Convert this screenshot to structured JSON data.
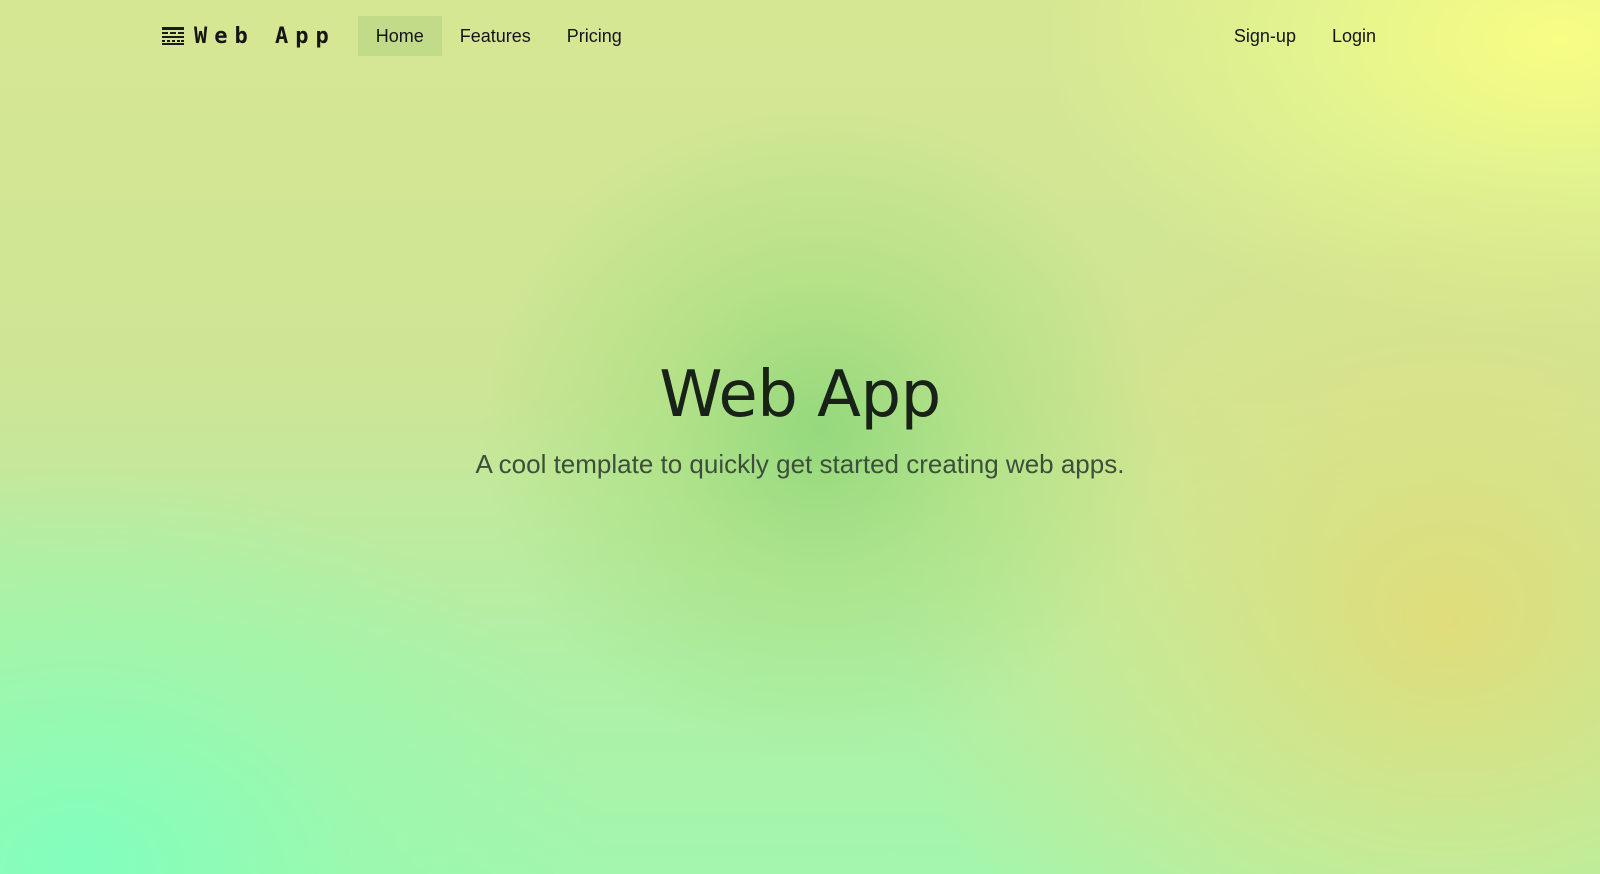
{
  "nav": {
    "brand": {
      "icon": "grid-logo-icon",
      "text": "Web App"
    },
    "links": [
      {
        "label": "Home",
        "active": true
      },
      {
        "label": "Features",
        "active": false
      },
      {
        "label": "Pricing",
        "active": false
      }
    ],
    "auth": {
      "signup_label": "Sign-up",
      "login_label": "Login"
    }
  },
  "hero": {
    "title": "Web App",
    "subtitle": "A cool template to quickly get started creating web apps."
  },
  "colors": {
    "active_nav_bg": "#c3d896",
    "text": "#151515",
    "subtitle": "#3c4f3c"
  }
}
